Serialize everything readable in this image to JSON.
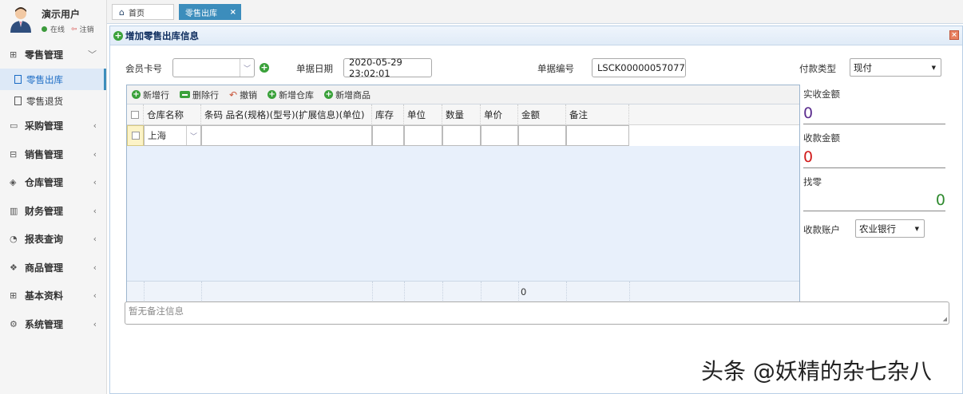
{
  "user": {
    "name": "演示用户",
    "status": "在线",
    "logout": "注销"
  },
  "sidebar": {
    "items": [
      {
        "label": "零售管理",
        "icon": "gift-icon",
        "open": true
      },
      {
        "label": "零售出库",
        "sub": true,
        "active": true
      },
      {
        "label": "零售退货",
        "sub": true
      },
      {
        "label": "采购管理",
        "icon": "comment-icon"
      },
      {
        "label": "销售管理",
        "icon": "briefcase-icon"
      },
      {
        "label": "仓库管理",
        "icon": "layers-icon"
      },
      {
        "label": "财务管理",
        "icon": "map-icon"
      },
      {
        "label": "报表查询",
        "icon": "pie-chart-icon"
      },
      {
        "label": "商品管理",
        "icon": "stack-icon"
      },
      {
        "label": "基本资料",
        "icon": "grid-icon"
      },
      {
        "label": "系统管理",
        "icon": "gear-icon"
      }
    ]
  },
  "tabs": {
    "home": "首页",
    "current": "零售出库"
  },
  "panel": {
    "title": "增加零售出库信息"
  },
  "form": {
    "member_card_label": "会员卡号",
    "member_card_value": "",
    "date_label": "单据日期",
    "date_value": "2020-05-29 23:02:01",
    "number_label": "单据编号",
    "number_value": "LSCK00000057077",
    "pay_type_label": "付款类型",
    "pay_type_value": "现付"
  },
  "toolbar": {
    "add_row": "新增行",
    "delete_row": "删除行",
    "undo": "撤销",
    "add_warehouse": "新增仓库",
    "add_product": "新增商品"
  },
  "grid": {
    "columns": [
      "仓库名称",
      "条码 品名(规格)(型号)(扩展信息)(单位)",
      "库存",
      "单位",
      "数量",
      "单价",
      "金额",
      "备注"
    ],
    "rows": [
      {
        "warehouse": "上海",
        "product": "",
        "stock": "",
        "unit": "",
        "qty": "",
        "price": "",
        "amount": "",
        "remark": ""
      }
    ],
    "footer_amount": "0"
  },
  "summary": {
    "received_label": "实收金额",
    "received_value": "0",
    "collected_label": "收款金额",
    "collected_value": "0",
    "change_label": "找零",
    "change_value": "0",
    "account_label": "收款账户",
    "account_value": "农业银行"
  },
  "remark": {
    "placeholder": "暂无备注信息"
  },
  "watermark": "头条 @妖精的杂七杂八",
  "colors": {
    "accent": "#3c8dbc",
    "received": "#5b2d8e",
    "collected": "#d11b1b",
    "change": "#2f8a2f"
  }
}
